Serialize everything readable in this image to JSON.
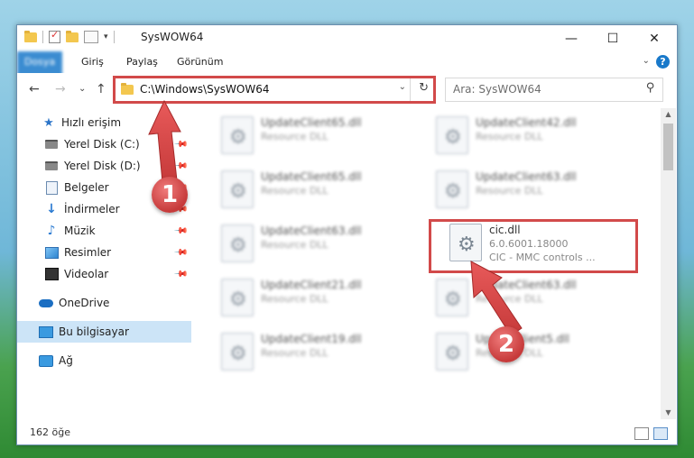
{
  "window": {
    "title": "SysWOW64",
    "minimize": "—",
    "maximize": "☐",
    "close": "✕"
  },
  "ribbon": {
    "tabs": [
      "Dosya",
      "Giriş",
      "Paylaş",
      "Görünüm"
    ],
    "expand": "⌄",
    "help": "?"
  },
  "nav": {
    "back": "←",
    "forward": "→",
    "recent": "⌄",
    "up": "↑",
    "address": "C:\\Windows\\SysWOW64",
    "address_dropdown": "⌄",
    "refresh": "↻",
    "search_placeholder": "Ara: SysWOW64",
    "search_icon": "⚲"
  },
  "sidebar": {
    "items": [
      {
        "label": "Hızlı erişim",
        "icon": "star-icon"
      },
      {
        "label": "Yerel Disk (C:)",
        "icon": "disk-icon"
      },
      {
        "label": "Yerel Disk (D:)",
        "icon": "disk-icon"
      },
      {
        "label": "Belgeler",
        "icon": "document-icon"
      },
      {
        "label": "İndirmeler",
        "icon": "download-icon"
      },
      {
        "label": "Müzik",
        "icon": "music-icon"
      },
      {
        "label": "Resimler",
        "icon": "pictures-icon"
      },
      {
        "label": "Videolar",
        "icon": "video-icon"
      },
      {
        "label": "OneDrive",
        "icon": "cloud-icon"
      },
      {
        "label": "Bu bilgisayar",
        "icon": "computer-icon"
      },
      {
        "label": "Ağ",
        "icon": "network-icon"
      }
    ],
    "pin": "📌"
  },
  "files": [
    {
      "name": "UpdateClient65.dll",
      "desc": "Resource DLL"
    },
    {
      "name": "UpdateClient42.dll",
      "desc": "Resource DLL"
    },
    {
      "name": "UpdateClient65.dll",
      "desc": "Resource DLL"
    },
    {
      "name": "UpdateClient63.dll",
      "desc": "Resource DLL"
    },
    {
      "name": "UpdateClient63.dll",
      "desc": "Resource DLL"
    },
    {
      "name": "cic.dll",
      "desc": "6.0.6001.18000",
      "desc2": "CIC - MMC controls ..."
    },
    {
      "name": "UpdateClient21.dll",
      "desc": "Resource DLL"
    },
    {
      "name": "UpdateClient63.dll",
      "desc": "Resource DLL"
    },
    {
      "name": "UpdateClient19.dll",
      "desc": "Resource DLL"
    },
    {
      "name": "UpdateClient5.dll",
      "desc": "Resource DLL"
    }
  ],
  "gear": "⚙",
  "scroll": {
    "up": "▲",
    "down": "▼"
  },
  "status": {
    "count": "162 öğe"
  },
  "callouts": [
    "1",
    "2"
  ],
  "colors": {
    "accent": "#1979ca",
    "highlight": "#d24a4a",
    "selection": "#cce4f7"
  }
}
